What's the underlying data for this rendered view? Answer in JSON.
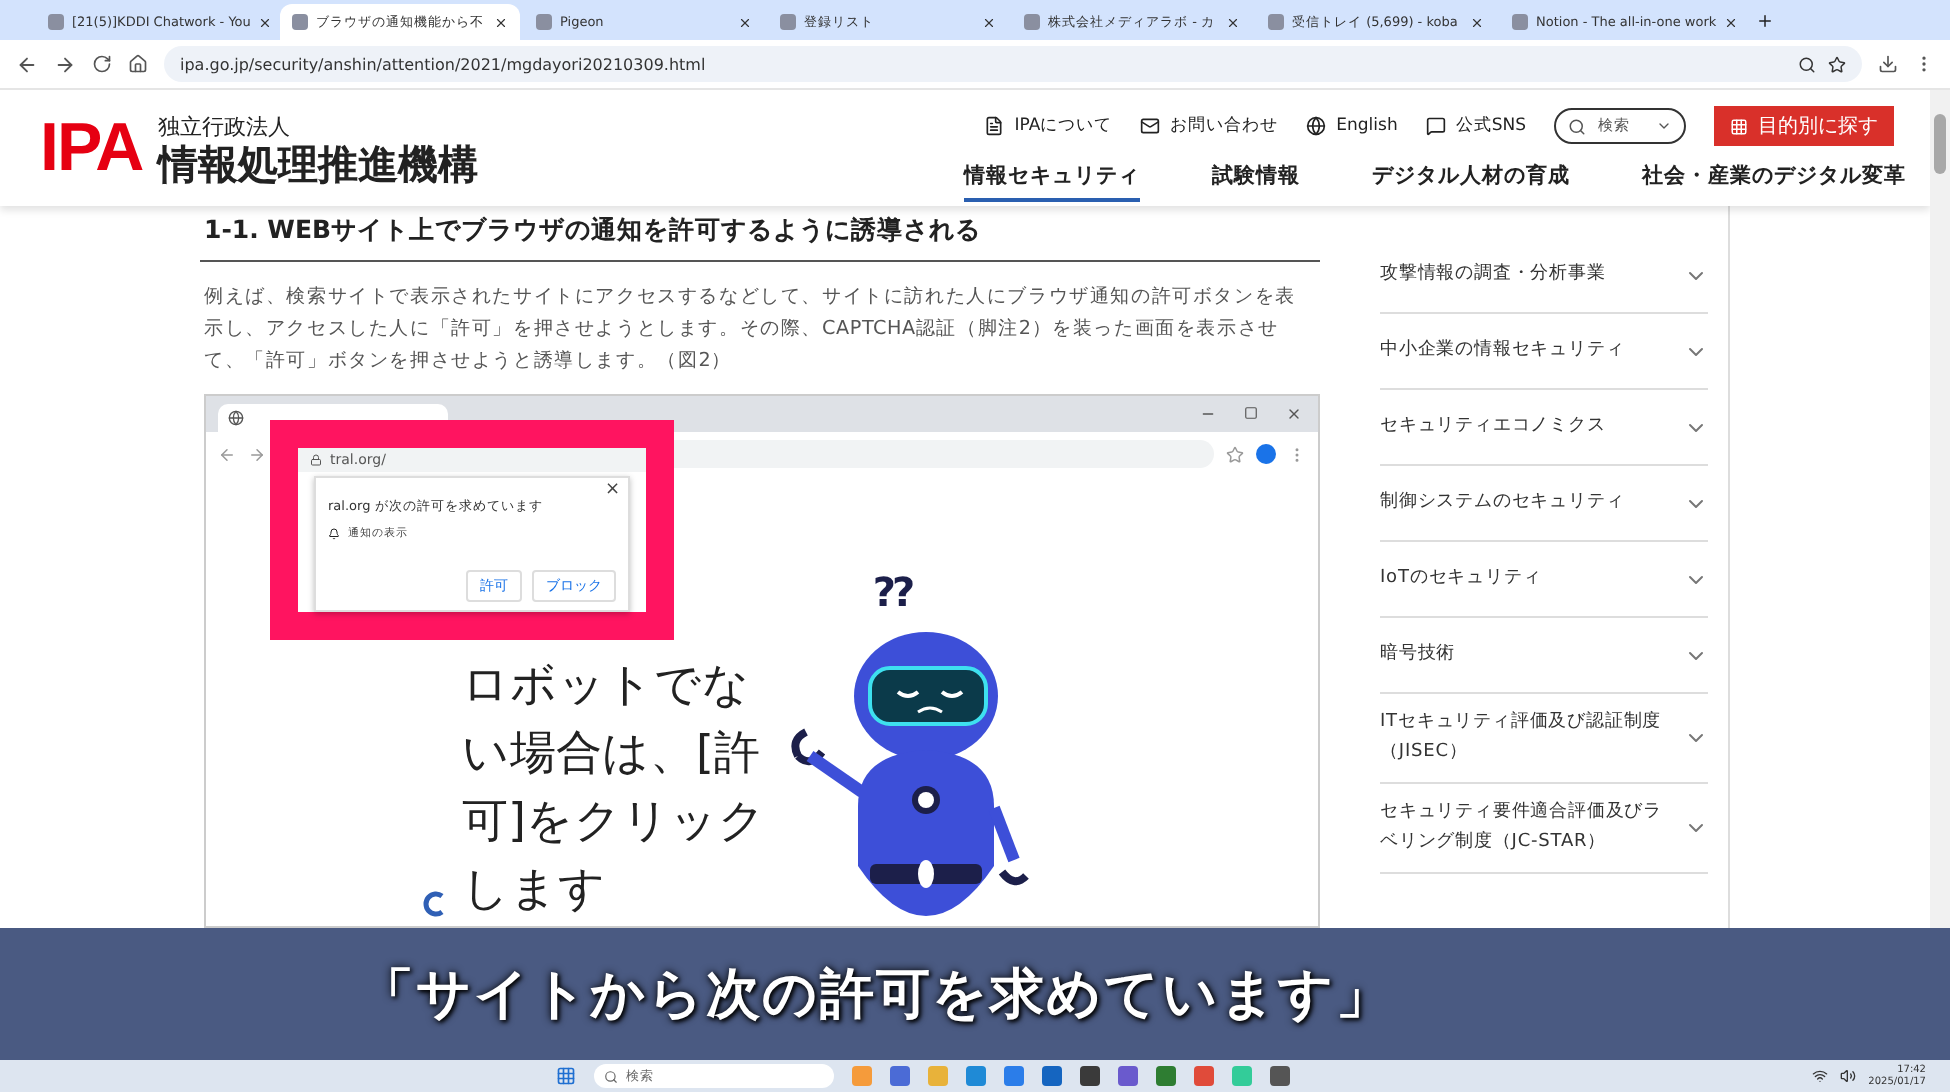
{
  "browser": {
    "tabs": [
      {
        "title": "[21(5)]KDDI Chatwork - You",
        "selected": false
      },
      {
        "title": "ブラウザの通知機能から不",
        "selected": true
      },
      {
        "title": "Pigeon",
        "selected": false
      },
      {
        "title": "登録リスト",
        "selected": false
      },
      {
        "title": "株式会社メディアラボ - カ",
        "selected": false
      },
      {
        "title": "受信トレイ (5,699) - koba",
        "selected": false
      },
      {
        "title": "Notion - The all-in-one work",
        "selected": false
      }
    ],
    "url": "ipa.go.jp/security/anshin/attention/2021/mgdayori20210309.html"
  },
  "header": {
    "logo": "IPA",
    "org_type": "独立行政法人",
    "org_name": "情報処理推進機構",
    "utility_links": [
      "IPAについて",
      "お問い合わせ",
      "English",
      "公式SNS"
    ],
    "search": {
      "placeholder": "検索"
    },
    "purpose_button": "目的別に探す",
    "nav": [
      {
        "label": "情報セキュリティ",
        "selected": true
      },
      {
        "label": "試験情報",
        "selected": false
      },
      {
        "label": "デジタル人材の育成",
        "selected": false
      },
      {
        "label": "社会・産業のデジタル変革",
        "selected": false
      }
    ]
  },
  "article": {
    "heading": "1-1. WEBサイト上でブラウザの通知を許可するように誘導される",
    "paragraph": "例えば、検索サイトで表示されたサイトにアクセスするなどして、サイトに訪れた人にブラウザ通知の許可ボタンを表示し、アクセスした人に「許可」を押させようとします。その際、CAPTCHA認証（脚注2）を装った画面を表示させて、「許可」ボタンを押させようと誘導します。（図2）",
    "figure": {
      "address_fragment": "tral.org/",
      "popup": {
        "close": "×",
        "message": "ral.org が次の許可を求めています",
        "permission": "通知の表示",
        "buttons": [
          "許可",
          "ブロック"
        ]
      },
      "caption_lines": [
        "ロボットでな",
        "い場合は、[許",
        "可]をクリック",
        "します"
      ],
      "robot_mark": "??"
    }
  },
  "sidebar": {
    "items": [
      {
        "label": "攻撃情報の調査・分析事業",
        "expanded": false
      },
      {
        "label": "中小企業の情報セキュリティ",
        "expanded": false
      },
      {
        "label": "セキュリティエコノミクス",
        "expanded": false
      },
      {
        "label": "制御システムのセキュリティ",
        "expanded": false
      },
      {
        "label": "IoTのセキュリティ",
        "expanded": false
      },
      {
        "label": "暗号技術",
        "expanded": false
      },
      {
        "label": "ITセキュリティ評価及び認証制度（JISEC）",
        "expanded": false
      },
      {
        "label": "セキュリティ要件適合評価及びラベリング制度（JC-STAR）",
        "expanded": false
      }
    ]
  },
  "subtitle": "「サイトから次の許可を求めています」",
  "taskbar": {
    "search": {
      "placeholder": "検索"
    },
    "time": "17:42",
    "date": "2025/01/17"
  }
}
